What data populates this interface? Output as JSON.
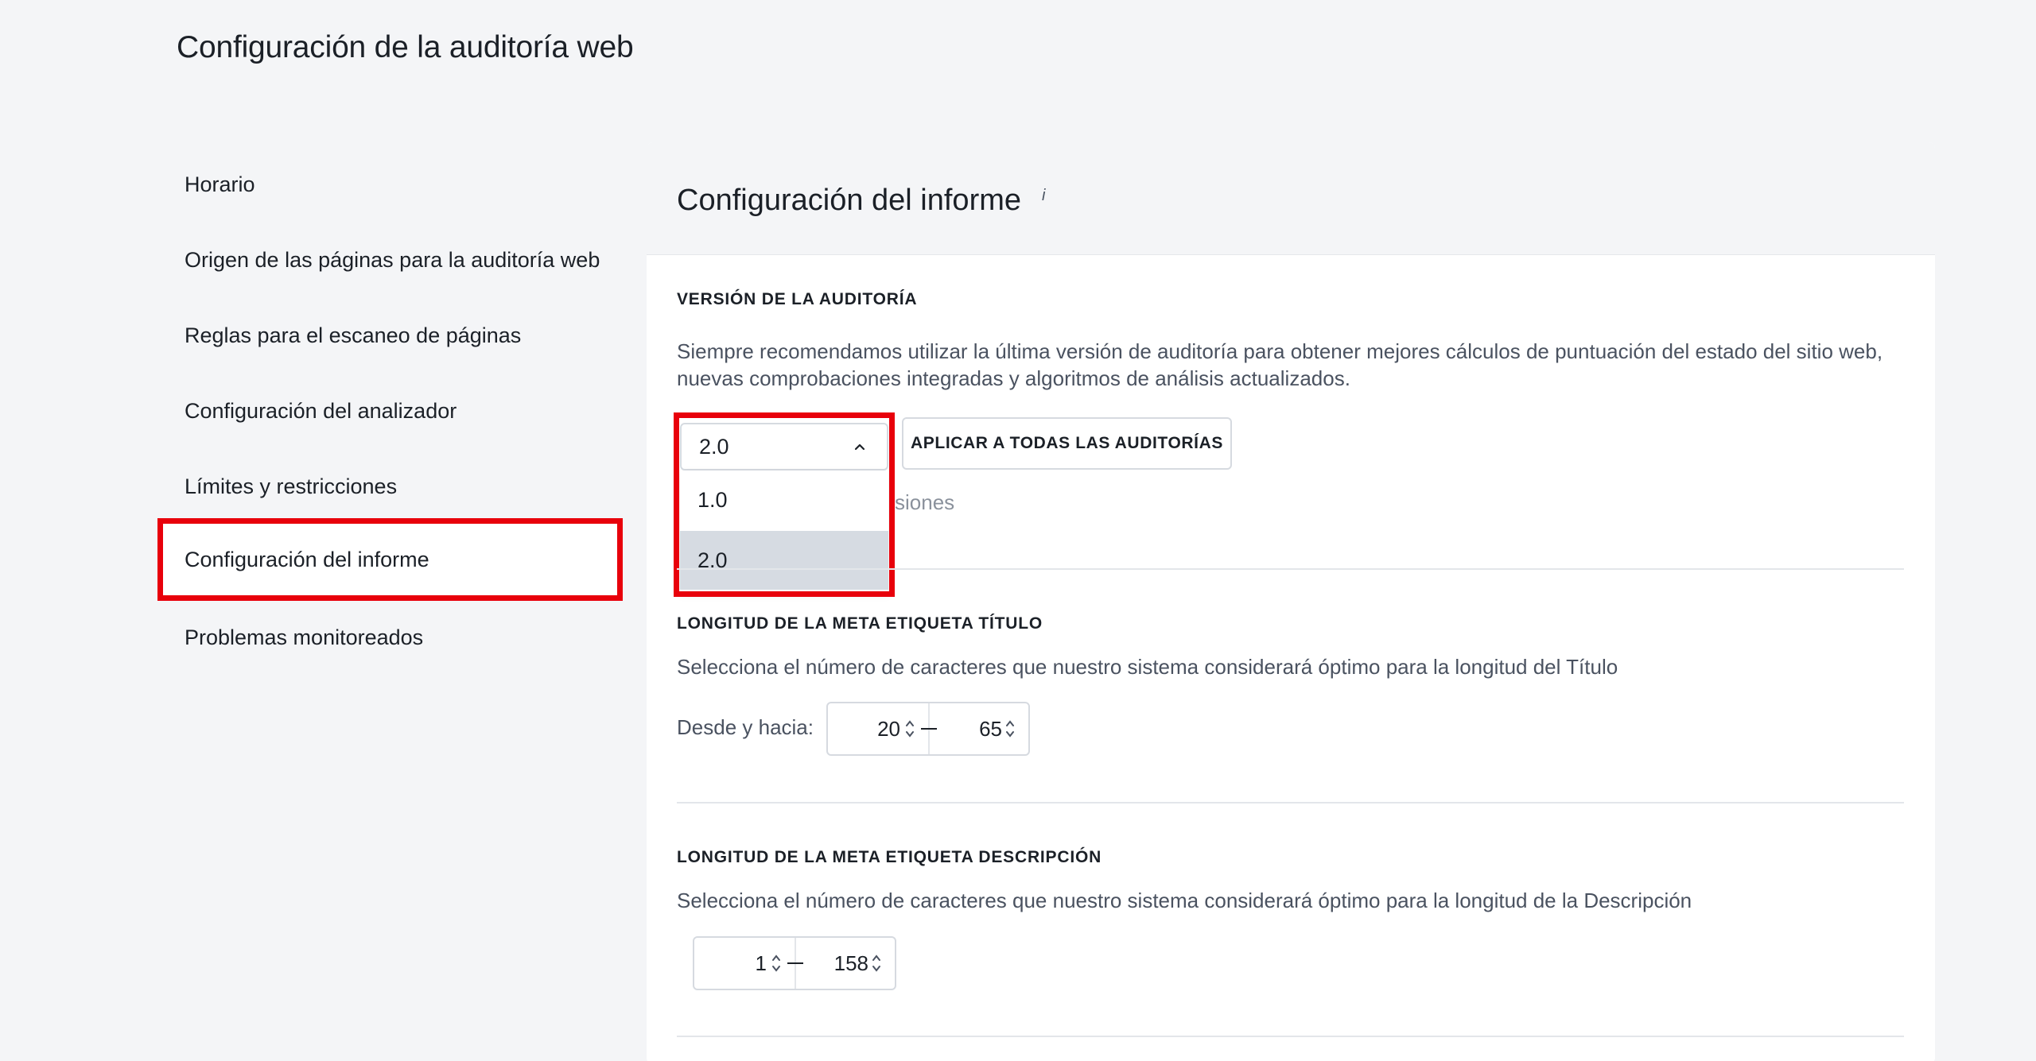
{
  "page_title": "Configuración de la auditoría web",
  "sidebar": {
    "items": [
      {
        "label": "Horario"
      },
      {
        "label": "Origen de las páginas para la auditoría web"
      },
      {
        "label": "Reglas para el escaneo de páginas"
      },
      {
        "label": "Configuración del analizador"
      },
      {
        "label": "Límites y restricciones"
      },
      {
        "label": "Configuración del informe",
        "active": true
      },
      {
        "label": "Problemas monitoreados"
      }
    ]
  },
  "panel": {
    "title": "Configuración del informe",
    "info_mark": "i",
    "audit_version": {
      "label": "VERSIÓN DE LA AUDITORÍA",
      "description": "Siempre recomendamos utilizar la última versión de auditoría para obtener mejores cálculos de puntuación del estado del sitio web, nuevas comprobaciones integradas y algoritmos de análisis actualizados.",
      "selected": "2.0",
      "options": [
        "1.0",
        "2.0"
      ],
      "apply_button": "APLICAR A TODAS LAS AUDITORÍAS",
      "partial_text": "siones"
    },
    "title_length": {
      "label": "LONGITUD DE LA META ETIQUETA TÍTULO",
      "description": "Selecciona el número de caracteres que nuestro sistema considerará óptimo para la longitud del Título",
      "range_label": "Desde y hacia:",
      "from": "20",
      "to": "65"
    },
    "description_length": {
      "label": "LONGITUD DE LA META ETIQUETA DESCRIPCIÓN",
      "description": "Selecciona el número de caracteres que nuestro sistema considerará óptimo para la longitud de la Descripción",
      "from": "1",
      "to": "158"
    }
  },
  "colors": {
    "highlight": "#e8000b",
    "selected_option": "#d6dbe2",
    "background": "#f4f5f7"
  }
}
